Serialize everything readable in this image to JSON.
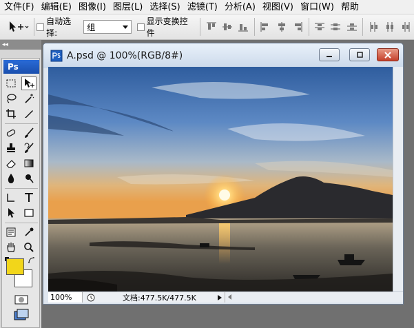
{
  "menubar": {
    "items": [
      {
        "label": "文件(F)"
      },
      {
        "label": "编辑(E)"
      },
      {
        "label": "图像(I)"
      },
      {
        "label": "图层(L)"
      },
      {
        "label": "选择(S)"
      },
      {
        "label": "滤镜(T)"
      },
      {
        "label": "分析(A)"
      },
      {
        "label": "视图(V)"
      },
      {
        "label": "窗口(W)"
      },
      {
        "label": "帮助"
      }
    ]
  },
  "options": {
    "auto_select_label": "自动选择:",
    "auto_select_value": "组",
    "auto_select_checked": false,
    "show_transform_label": "显示变换控件",
    "show_transform_checked": false
  },
  "toolbox": {
    "handle": "◂◂",
    "badge": "Ps",
    "foreground_color": "#f2d61a",
    "background_color": "#ffffff"
  },
  "document": {
    "title": "A.psd @ 100%(RGB/8#)",
    "zoom": "100%",
    "doc_size": "文档:477.5K/477.5K"
  }
}
